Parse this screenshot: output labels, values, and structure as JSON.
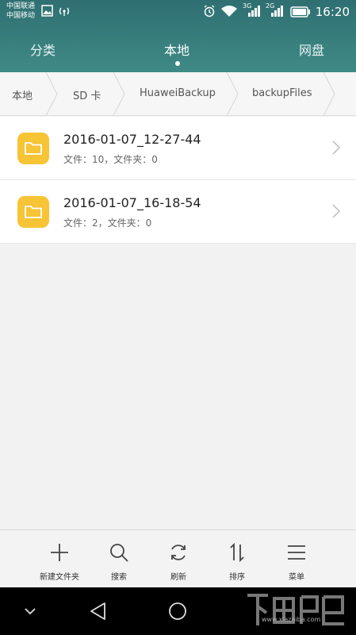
{
  "status": {
    "carrier1": "中国联通",
    "carrier2": "中国移动",
    "net1": "3G",
    "net2": "2G",
    "time": "16:20"
  },
  "tabs": [
    {
      "label": "分类"
    },
    {
      "label": "本地"
    },
    {
      "label": "网盘"
    }
  ],
  "breadcrumb": [
    {
      "label": "本地"
    },
    {
      "label": "SD 卡"
    },
    {
      "label": "HuaweiBackup"
    },
    {
      "label": "backupFiles"
    }
  ],
  "files": [
    {
      "name": "2016-01-07_12-27-44",
      "meta": "文件：10，文件夹：0",
      "icon": "folder-icon"
    },
    {
      "name": "2016-01-07_16-18-54",
      "meta": "文件：2，文件夹：0",
      "icon": "folder-icon"
    }
  ],
  "toolbar": {
    "new_folder": "新建文件夹",
    "search": "搜索",
    "refresh": "刷新",
    "sort": "排序",
    "menu": "菜单"
  },
  "watermark": "www.xiazaiba.com",
  "colors": {
    "header": "#3a7f7e",
    "folder": "#f7c436",
    "background": "#f2f2f2"
  }
}
